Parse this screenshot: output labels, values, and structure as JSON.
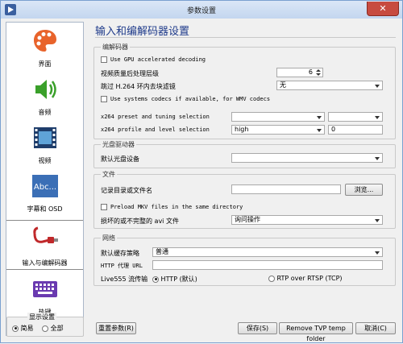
{
  "window": {
    "title": "参数设置",
    "close_symbol": "✕"
  },
  "sidebar": {
    "items": [
      {
        "label": "界面",
        "icon": "palette-icon"
      },
      {
        "label": "音频",
        "icon": "speaker-icon"
      },
      {
        "label": "视频",
        "icon": "film-icon"
      },
      {
        "label": "字幕和 OSD",
        "icon": "subtitle-abc-icon"
      },
      {
        "label": "输入与编解码器",
        "icon": "cable-plug-icon",
        "selected": true
      },
      {
        "label": "热键",
        "icon": "keyboard-icon"
      }
    ]
  },
  "display": {
    "legend": "显示设置",
    "simple": "简易",
    "all": "全部",
    "selected": "简易"
  },
  "page_title": "输入和编解码器设置",
  "codecs": {
    "label": "编解码器",
    "gpu_decoding": "Use GPU accelerated decoding",
    "postproc_label": "视频质量后处理层级",
    "postproc_value": "6",
    "skip_loop_label": "跳过 H.264 环内去块滤镜",
    "skip_loop_value": "无",
    "system_codecs": "Use systems codecs if available, for WMV codecs",
    "x264_preset_label": "x264 preset and tuning selection",
    "x264_profile_label": "x264 profile and level selection",
    "x264_profile_value": "high",
    "x264_level_value": "0"
  },
  "disc": {
    "label": "光盘驱动器",
    "default_device_label": "默认光盘设备",
    "default_device_value": ""
  },
  "files": {
    "label": "文件",
    "record_dir_label": "记录目录或文件名",
    "record_dir_value": "",
    "browse": "浏览...",
    "preload_mkv": "Preload MKV files in the same directory",
    "avi_label": "损坏的或不完整的 avi 文件",
    "avi_value": "询问操作"
  },
  "network": {
    "label": "网络",
    "cache_policy_label": "默认缓存策略",
    "cache_policy_value": "普通",
    "http_proxy_label": "HTTP 代理 URL",
    "http_proxy_value": "",
    "live555_label": "Live555 流传输",
    "http_option": "HTTP (默认)",
    "rtp_option": "RTP over RTSP (TCP)",
    "selected": "HTTP (默认)"
  },
  "buttons": {
    "reset": "重置参数(R)",
    "save": "保存(S)",
    "remove_tvp": "Remove TVP temp folder",
    "cancel": "取消(C)"
  }
}
